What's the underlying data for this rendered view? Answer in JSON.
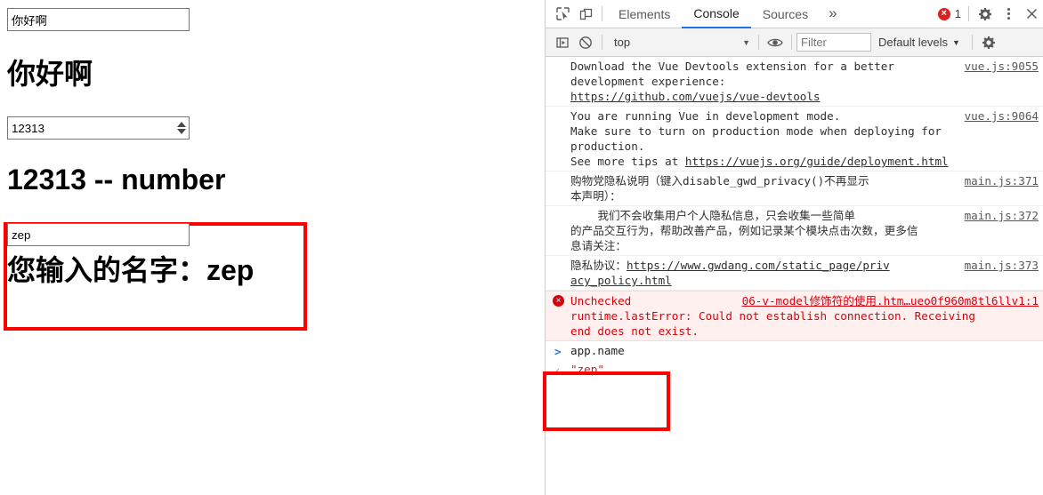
{
  "app": {
    "left_panel": {
      "hello_input_value": "你好啊",
      "hello_heading": "你好啊",
      "number_input_value": "12313",
      "number_heading": "12313 -- number",
      "name_input_value": "zep",
      "name_heading": "您输入的名字：zep"
    }
  },
  "devtools": {
    "tabs": [
      {
        "label": "Elements",
        "active": false
      },
      {
        "label": "Console",
        "active": true
      },
      {
        "label": "Sources",
        "active": false
      }
    ],
    "more_tabs_label": "»",
    "error_count": "1",
    "icons": {
      "inspect": "inspect-element-icon",
      "device": "device-toolbar-icon",
      "settings": "gear-icon",
      "kebab": "more-options-icon",
      "close": "close-icon",
      "sidebar": "console-sidebar-icon",
      "clear": "clear-console-icon",
      "eye": "live-expression-eye-icon",
      "console_settings": "console-settings-gear-icon"
    },
    "console_toolbar": {
      "context_value": "top",
      "filter_placeholder": "Filter",
      "filter_value": "",
      "levels_label": "Default levels",
      "caret": "▼"
    },
    "messages": [
      {
        "type": "log",
        "lines": [
          "Download the Vue Devtools extension for a better",
          "development experience:"
        ],
        "link": "https://github.com/vuejs/vue-devtools",
        "source": "vue.js:9055"
      },
      {
        "type": "log",
        "lines": [
          "You are running Vue in development mode.",
          "Make sure to turn on production mode when deploying for",
          "production."
        ],
        "tail_prefix": "See more tips at ",
        "tail_link": "https://vuejs.org/guide/deployment.html",
        "source": "vue.js:9064"
      },
      {
        "type": "log",
        "lines": [
          "购物党隐私说明（键入disable_gwd_privacy()不再显示",
          "本声明）："
        ],
        "source": "main.js:371"
      },
      {
        "type": "log",
        "lines": [
          "    我们不会收集用户个人隐私信息，只会收集一些简单",
          "的产品交互行为，帮助改善产品，例如记录某个模块点击次数，更多信",
          "息请关注："
        ],
        "source": "main.js:372"
      },
      {
        "type": "log",
        "prefix": "隐私协议：",
        "link": "https://www.gwdang.com/static_page/privacy_policy.html",
        "link_display_1": "https://www.gwdang.com/static_page/priv",
        "link_display_2": "acy_policy.html",
        "source": "main.js:373"
      },
      {
        "type": "error",
        "line1": "Unchecked",
        "line2": "runtime.lastError: Could not establish connection. Receiving",
        "line3": "end does not exist.",
        "source": "06-v-model修饰符的使用.htm…ueo0f960m8tl6llv1:1"
      }
    ],
    "prompt": {
      "chevron": ">",
      "input_text": "app.name",
      "result_chevron": "‹",
      "result_text": "\"zep\""
    }
  },
  "annotations": {
    "highlight_color": "#ff0000"
  }
}
